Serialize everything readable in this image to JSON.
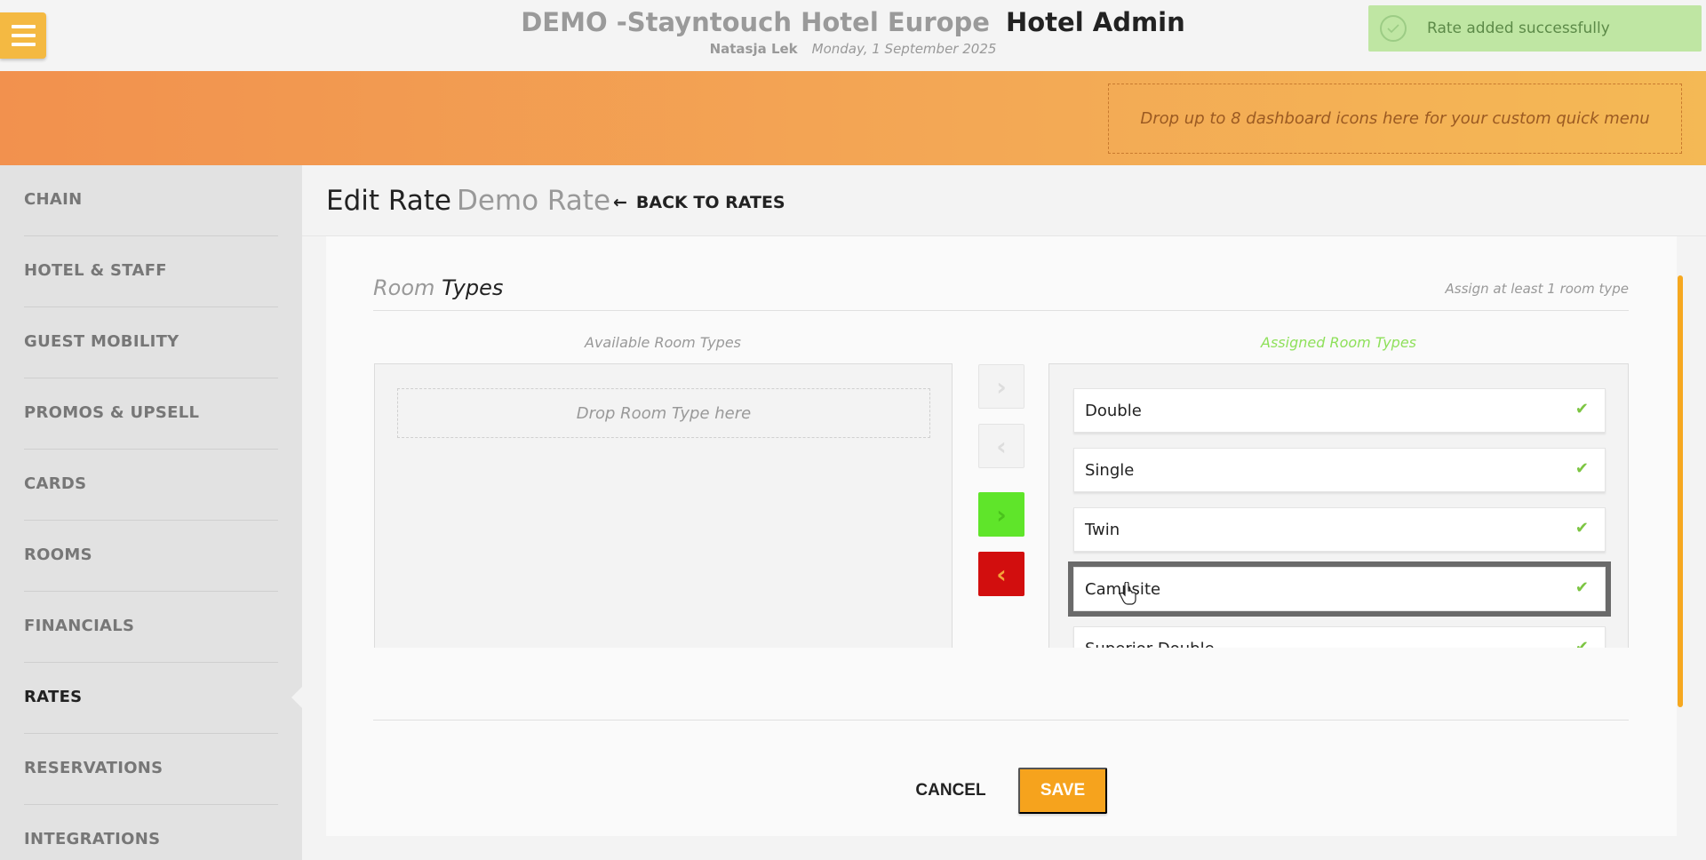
{
  "header": {
    "hotel_name": "DEMO -Stayntouch Hotel Europe",
    "app_name": "Hotel Admin",
    "user": "Natasja Lek",
    "date": "Monday, 1 September 2025",
    "menu_icon": "hamburger-menu-icon"
  },
  "toast": {
    "message": "Rate added successfully",
    "icon": "check-circle-icon"
  },
  "quick_menu": {
    "placeholder": "Drop up to 8 dashboard icons here for your custom quick menu"
  },
  "sidebar": {
    "items": [
      {
        "label": "CHAIN"
      },
      {
        "label": "HOTEL & STAFF"
      },
      {
        "label": "GUEST MOBILITY"
      },
      {
        "label": "PROMOS & UPSELL"
      },
      {
        "label": "CARDS"
      },
      {
        "label": "ROOMS"
      },
      {
        "label": "FINANCIALS"
      },
      {
        "label": "RATES"
      },
      {
        "label": "RESERVATIONS"
      },
      {
        "label": "INTEGRATIONS"
      }
    ],
    "active": "RATES"
  },
  "page": {
    "title": "Edit Rate",
    "rate_name": "Demo Rate",
    "back_label": "BACK TO RATES",
    "back_arrow": "←"
  },
  "room_types": {
    "title_light": "Room",
    "title_dark": "Types",
    "hint": "Assign at least 1 room type",
    "available_label": "Available Room Types",
    "assigned_label": "Assigned Room Types",
    "drop_placeholder": "Drop Room Type here",
    "assigned": [
      {
        "name": "Double",
        "check": "✔"
      },
      {
        "name": "Single",
        "check": "✔"
      },
      {
        "name": "Twin",
        "check": "✔"
      },
      {
        "name": "Campsite",
        "check": "✔"
      },
      {
        "name": "Superior Double",
        "check": "✔"
      }
    ],
    "highlighted": "Campsite",
    "buttons": {
      "move_right": "›",
      "move_left": "‹",
      "move_all_right": "›",
      "move_all_left": "‹"
    },
    "colors": {
      "assigned_label": "#8ee05a",
      "move_all_right": "#5fe52a",
      "move_all_left": "#d20e0e"
    }
  },
  "actions": {
    "cancel": "CANCEL",
    "save": "SAVE"
  },
  "colors": {
    "accent": "#f6a31d",
    "menu_button": "#f4b942",
    "toast_bg": "#bfe6a3"
  }
}
